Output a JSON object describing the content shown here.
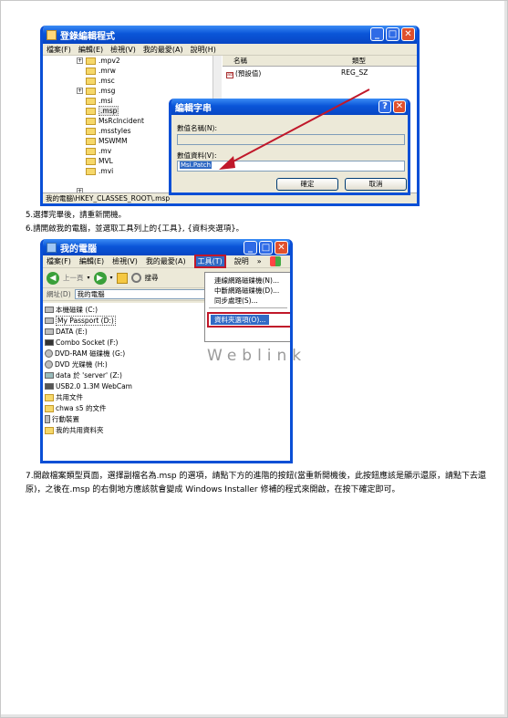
{
  "regedit": {
    "title": "登錄編輯程式",
    "menu": [
      "檔案(F)",
      "編輯(E)",
      "檢視(V)",
      "我的最愛(A)",
      "說明(H)"
    ],
    "tree": [
      ".mpv2",
      ".mrw",
      ".msc",
      ".msg",
      ".msi",
      ".msp",
      "MsRcIncident",
      ".msstyles",
      "MSWMM",
      ".mv",
      "MVL",
      ".mvi"
    ],
    "selected": ".msp",
    "columns": {
      "name": "名稱",
      "type": "類型"
    },
    "row": {
      "name": "(預設值)",
      "type": "REG_SZ"
    },
    "status": "我的電腦\\HKEY_CLASSES_ROOT\\.msp"
  },
  "edit_dialog": {
    "title": "編輯字串",
    "value_name_label": "數值名稱(N):",
    "value_name": "",
    "value_data_label": "數值資料(V):",
    "value_data": "Msi.Patch",
    "ok": "確定",
    "cancel": "取消",
    "help_btn": "?",
    "close_btn": "✕"
  },
  "steps": {
    "step5": "5.選擇完畢後，請重新開機。",
    "step6": "6.請開啟我的電腦，並選取工具列上的{工具}, {資料夾選項}。"
  },
  "mycomputer": {
    "title": "我的電腦",
    "menu": [
      "檔案(F)",
      "編輯(E)",
      "檢視(V)",
      "我的最愛(A)",
      "工具(T)",
      "說明"
    ],
    "menu_more": "»",
    "back": "上一頁",
    "search": "搜尋",
    "address_label": "網址(D)",
    "address": "我的電腦",
    "drives": [
      "本機磁碟 (C:)",
      "My Passport (D:)",
      "DATA (E:)",
      "Combo Socket (F:)",
      "DVD-RAM 磁碟機 (G:)",
      "DVD 光碟機 (H:)",
      "data 於 'server' (Z:)",
      "USB2.0 1.3M WebCam",
      "共用文件",
      "chwa s5 的文件",
      "行動裝置",
      "我的共用資料夾"
    ],
    "tools_menu": [
      "連線網路磁碟機(N)...",
      "中斷網路磁碟機(D)...",
      "同步處理(S)...",
      "資料夾選項(O)..."
    ]
  },
  "watermark": "Weblink",
  "step7": "7.開啟檔案類型頁面，選擇副檔名為.msp 的選項，請點下方的進階的按鈕(當重新開機後，此按鈕應該是顯示還原，請點下去還原)，之後在.msp 的右側地方應該就會變成 Windows Installer 修補的程式來開啟，在按下確定即可。",
  "colors": {
    "xp_blue": "#0a55d8",
    "highlight_red": "#c0182a",
    "selection": "#316ac5"
  }
}
